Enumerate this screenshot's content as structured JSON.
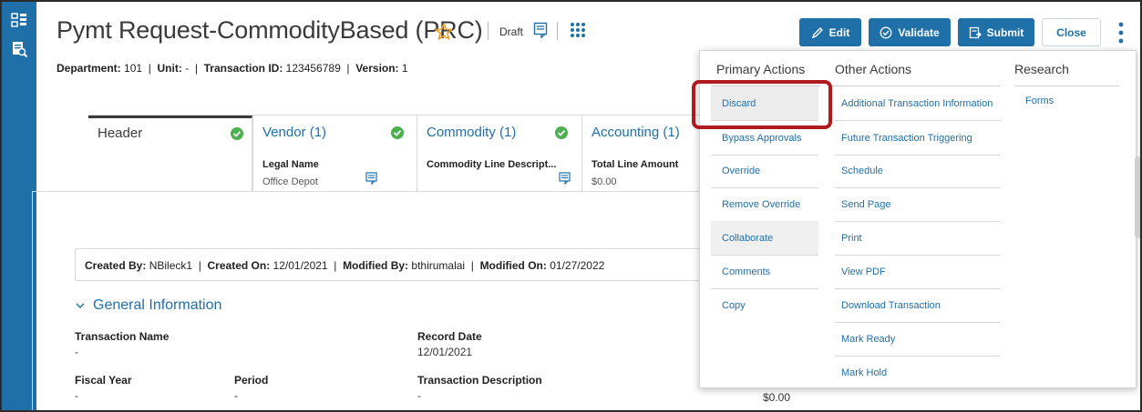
{
  "header": {
    "title": "Pymt Request-CommodityBased (PRC)",
    "status": "Draft",
    "meta": {
      "department_label": "Department:",
      "department": "101",
      "unit_label": "Unit:",
      "unit": "-",
      "txn_label": "Transaction ID:",
      "txn": "123456789",
      "version_label": "Version:",
      "version": "1"
    },
    "buttons": {
      "edit": "Edit",
      "validate": "Validate",
      "submit": "Submit",
      "close": "Close"
    }
  },
  "tabs": [
    {
      "title": "Header",
      "checked": true
    },
    {
      "title": "Vendor (1)",
      "checked": true,
      "sub_label": "Legal Name",
      "sub_value": "Office Depot"
    },
    {
      "title": "Commodity (1)",
      "checked": true,
      "sub_label": "Commodity Line Descript...",
      "sub_value": ""
    },
    {
      "title": "Accounting (1)",
      "checked": false,
      "sub_label": "Total Line Amount",
      "sub_value": "$0.00"
    }
  ],
  "audit": {
    "created_by_label": "Created By:",
    "created_by": "NBileck1",
    "created_on_label": "Created On:",
    "created_on": "12/01/2021",
    "modified_by_label": "Modified By:",
    "modified_by": "bthirumalai",
    "modified_on_label": "Modified On:",
    "modified_on": "01/27/2022"
  },
  "general": {
    "section_title": "General Information",
    "fields": {
      "txn_name_label": "Transaction Name",
      "txn_name_value": "-",
      "record_date_label": "Record Date",
      "record_date_value": "12/01/2021",
      "fiscal_year_label": "Fiscal Year",
      "fiscal_year_value": "-",
      "period_label": "Period",
      "period_value": "-",
      "txn_desc_label": "Transaction Description",
      "txn_desc_value": "-",
      "amount_value": "$0.00"
    }
  },
  "actions_menu": {
    "primary_title": "Primary Actions",
    "other_title": "Other Actions",
    "research_title": "Research",
    "primary": [
      "Discard",
      "Bypass Approvals",
      "Override",
      "Remove Override",
      "Collaborate",
      "Comments",
      "Copy"
    ],
    "other": [
      "Additional Transaction Information",
      "Future Transaction Triggering",
      "Schedule",
      "Send Page",
      "Print",
      "View PDF",
      "Download Transaction",
      "Mark Ready",
      "Mark Hold"
    ],
    "research": [
      "Forms"
    ]
  },
  "colors": {
    "brand_blue": "#1f6fa8",
    "check_green": "#4caf50",
    "highlight_red": "#b0191e",
    "star_orange": "#f0a020"
  }
}
